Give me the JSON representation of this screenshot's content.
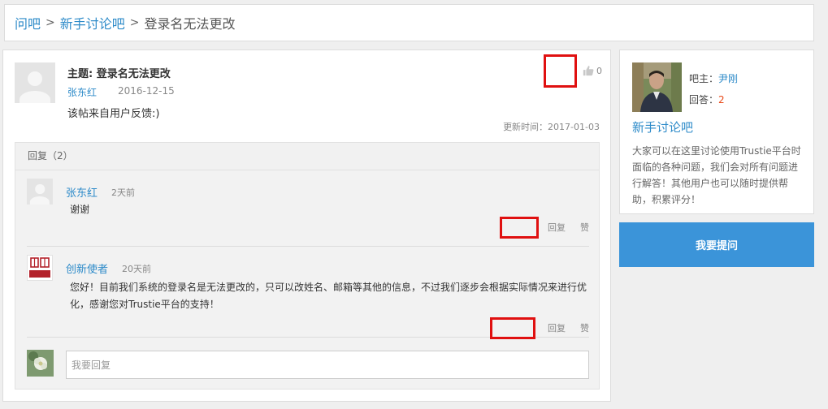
{
  "breadcrumb": {
    "items": [
      "问吧",
      "新手讨论吧"
    ],
    "separator": ">",
    "current": "登录名无法更改"
  },
  "topic": {
    "title": "主题: 登录名无法更改",
    "author": "张东红",
    "date": "2016-12-15",
    "body": "该帖来自用户反馈:)",
    "like_count": "0",
    "update_time": "更新时间：2017-01-03"
  },
  "replies": {
    "header": "回复（2）",
    "items": [
      {
        "name": "张东红",
        "time": "2天前",
        "content": "谢谢",
        "reply_label": "回复",
        "like_label": "赞",
        "avatar": "user-placeholder"
      },
      {
        "name": "创新使者",
        "time": "20天前",
        "content": "您好！目前我们系统的登录名是无法更改的，只可以改姓名、邮箱等其他的信息，不过我们逐步会根据实际情况来进行优化，感谢您对Trustie平台的支持！",
        "reply_label": "回复",
        "like_label": "赞",
        "avatar": "trustie-logo"
      }
    ],
    "composer_placeholder": "我要回复"
  },
  "sidebar": {
    "owner_label": "吧主：",
    "owner_name": "尹刚",
    "answers_label": "回答：",
    "answers_count": "2",
    "bar_name": "新手讨论吧",
    "description": "大家可以在这里讨论使用Trustie平台时面临的各种问题，我们会对所有问题进行解答！其他用户也可以随时提供帮助，积累评分！",
    "ask_button": "我要提问"
  },
  "colors": {
    "link": "#2e8bc9",
    "accent_button": "#3b94d9",
    "highlight_box": "#e01010",
    "answer_count": "#e84a1a"
  }
}
